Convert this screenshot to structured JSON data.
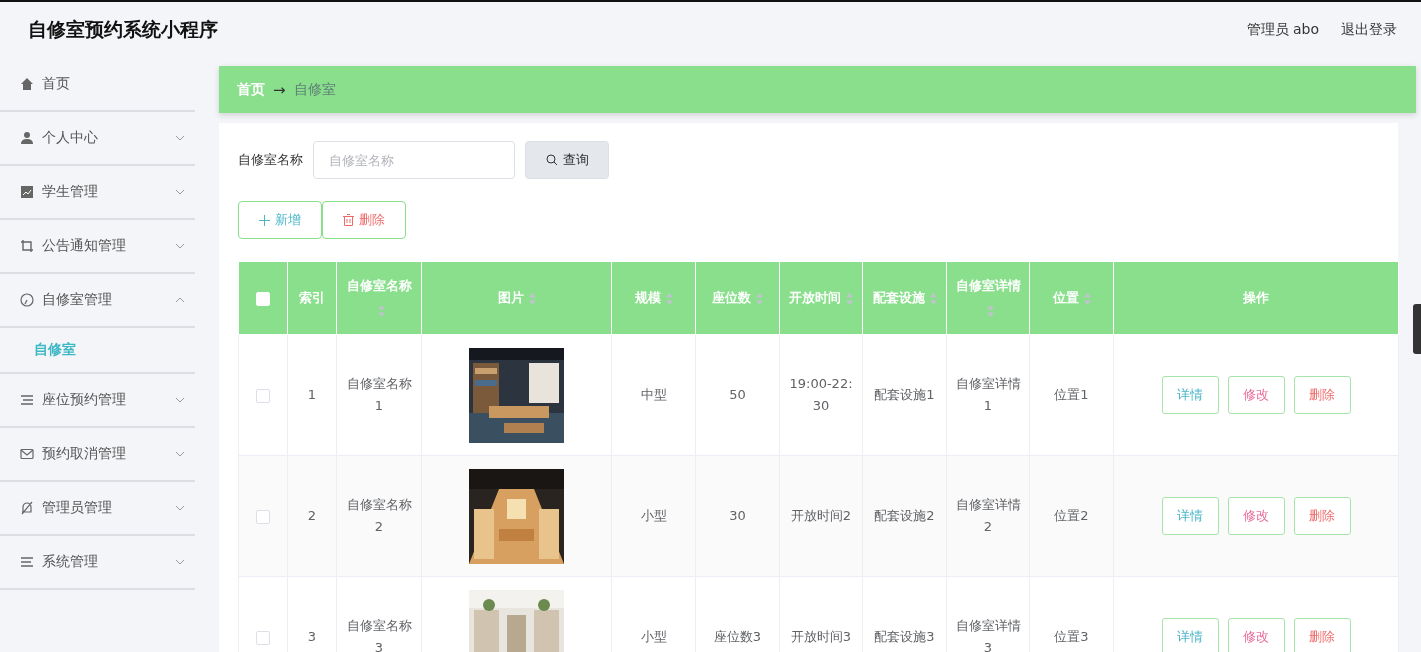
{
  "app_title": "自修室预约系统小程序",
  "user_label": "管理员 abo",
  "logout": "退出登录",
  "sidebar": {
    "items": [
      {
        "label": "首页"
      },
      {
        "label": "个人中心",
        "expanded": false
      },
      {
        "label": "学生管理",
        "expanded": false
      },
      {
        "label": "公告通知管理",
        "expanded": false
      },
      {
        "label": "自修室管理",
        "expanded": true,
        "children": [
          {
            "label": "自修室",
            "selected": true
          }
        ]
      },
      {
        "label": "座位预约管理",
        "expanded": false
      },
      {
        "label": "预约取消管理",
        "expanded": false
      },
      {
        "label": "管理员管理",
        "expanded": false
      },
      {
        "label": "系统管理",
        "expanded": false
      }
    ]
  },
  "breadcrumb": {
    "items": [
      "首页",
      "自修室"
    ],
    "separator": "→"
  },
  "search": {
    "label": "自修室名称",
    "placeholder": "自修室名称",
    "button": "查询"
  },
  "actions": [
    {
      "kind": "add",
      "label": "新增"
    },
    {
      "kind": "delete",
      "label": "删除"
    }
  ],
  "table": {
    "header_checkbox": {
      "checked": false
    },
    "columns": [
      {
        "label": "索引",
        "sortable": false
      },
      {
        "label": "自修室名称",
        "sortable": true
      },
      {
        "label": "图片",
        "sortable": true
      },
      {
        "label": "规模",
        "sortable": true
      },
      {
        "label": "座位数",
        "sortable": true
      },
      {
        "label": "开放时间",
        "sortable": true
      },
      {
        "label": "配套设施",
        "sortable": true
      },
      {
        "label": "自修室详情",
        "sortable": true
      },
      {
        "label": "位置",
        "sortable": true
      },
      {
        "label": "操作",
        "sortable": false
      }
    ],
    "rows": [
      {
        "selected": false,
        "cells": [
          "1",
          "自修室名称1",
          {
            "kind": "picture"
          },
          "中型",
          "50",
          "19:00-22:30",
          "配套设施1",
          "自修室详情1",
          "位置1"
        ],
        "buttons": [
          {
            "kind": "view",
            "label": "详情"
          },
          {
            "kind": "edit",
            "label": "修改"
          },
          {
            "kind": "delete",
            "label": "删除"
          }
        ]
      },
      {
        "selected": false,
        "cells": [
          "2",
          "自修室名称2",
          {
            "kind": "picture"
          },
          "小型",
          "30",
          "开放时间2",
          "配套设施2",
          "自修室详情2",
          "位置2"
        ],
        "buttons": [
          {
            "kind": "view",
            "label": "详情"
          },
          {
            "kind": "edit",
            "label": "修改"
          },
          {
            "kind": "delete",
            "label": "删除"
          }
        ]
      },
      {
        "selected": false,
        "cells": [
          "3",
          "自修室名称3",
          {
            "kind": "picture"
          },
          "小型",
          "座位数3",
          "开放时间3",
          "配套设施3",
          "自修室详情3",
          "位置3"
        ],
        "buttons": [
          {
            "kind": "view",
            "label": "详情"
          },
          {
            "kind": "edit",
            "label": "修改"
          },
          {
            "kind": "delete",
            "label": "删除"
          }
        ]
      }
    ]
  }
}
